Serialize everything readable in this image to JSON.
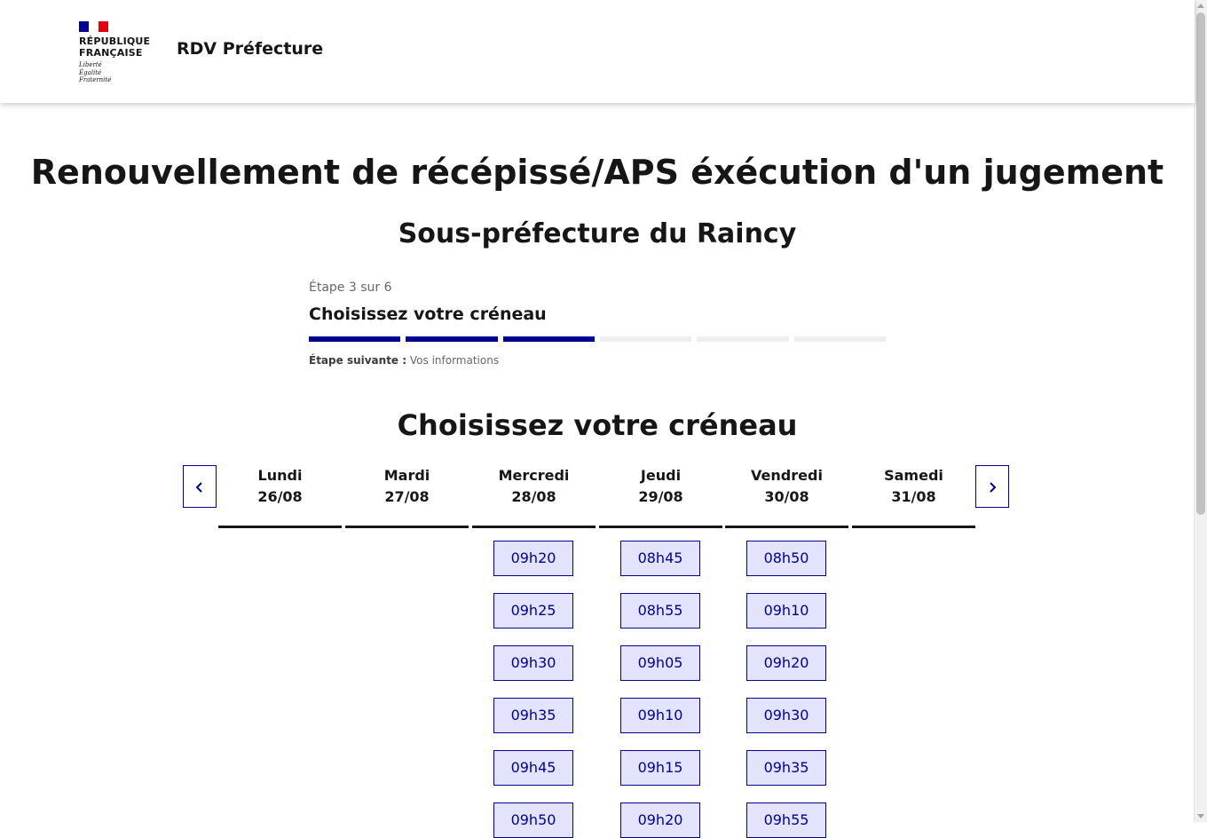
{
  "header": {
    "logo_lines": [
      "RÉPUBLIQUE",
      "FRANÇAISE"
    ],
    "motto": [
      "Liberté",
      "Égalité",
      "Fraternité"
    ],
    "service_title": "RDV Préfecture"
  },
  "page_title": "Renouvellement de récépissé/APS éxécution d'un jugement",
  "sub_title": "Sous-préfecture du Raincy",
  "stepper": {
    "count": "Étape 3 sur 6",
    "title": "Choisissez votre créneau",
    "current_step": 3,
    "total_steps": 6,
    "next_label": "Étape suivante :",
    "next_value": "Vos informations"
  },
  "slots_title": "Choisissez votre créneau",
  "colors": {
    "primary": "#000091",
    "slot_bg": "#e3e3fd",
    "text": "#161616"
  },
  "icons": {
    "prev": "chevron-left-icon",
    "next": "chevron-right-icon"
  },
  "days": [
    {
      "name": "Lundi",
      "date": "26/08",
      "slots": []
    },
    {
      "name": "Mardi",
      "date": "27/08",
      "slots": []
    },
    {
      "name": "Mercredi",
      "date": "28/08",
      "slots": [
        "09h20",
        "09h25",
        "09h30",
        "09h35",
        "09h45",
        "09h50"
      ]
    },
    {
      "name": "Jeudi",
      "date": "29/08",
      "slots": [
        "08h45",
        "08h55",
        "09h05",
        "09h10",
        "09h15",
        "09h20"
      ]
    },
    {
      "name": "Vendredi",
      "date": "30/08",
      "slots": [
        "08h50",
        "09h10",
        "09h20",
        "09h30",
        "09h35",
        "09h55"
      ]
    },
    {
      "name": "Samedi",
      "date": "31/08",
      "slots": []
    }
  ]
}
